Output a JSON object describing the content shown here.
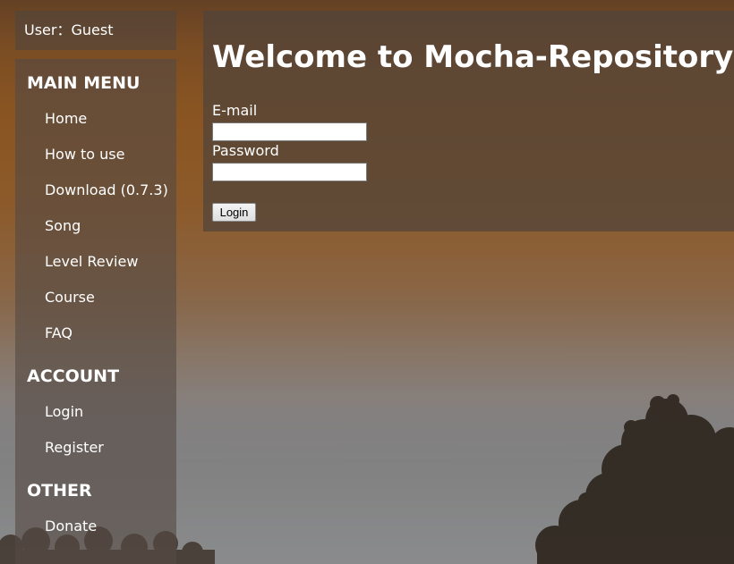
{
  "user_box": {
    "text": "User：Guest"
  },
  "sidebar": {
    "sections": [
      {
        "heading": "MAIN MENU",
        "items": [
          "Home",
          "How to use",
          "Download (0.7.3)",
          "Song",
          "Level Review",
          "Course",
          "FAQ"
        ]
      },
      {
        "heading": "ACCOUNT",
        "items": [
          "Login",
          "Register"
        ]
      },
      {
        "heading": "OTHER",
        "items": [
          "Donate"
        ]
      }
    ]
  },
  "main": {
    "title": "Welcome to Mocha-Repository",
    "email_label": "E-mail",
    "email_value": "",
    "password_label": "Password",
    "password_value": "",
    "login_button": "Login"
  },
  "colors": {
    "sky_top": "#6a4527",
    "sky_orange": "#8a5522",
    "sky_bottom": "#8a8b8c",
    "panel": "#50443a",
    "text": "#ffffff",
    "tree": "#2e261e"
  },
  "icons": {
    "background": "sunset-sky-with-tree-silhouettes"
  }
}
